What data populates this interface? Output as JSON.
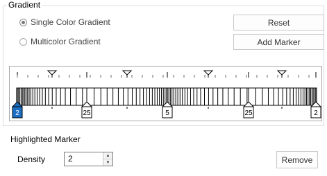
{
  "group": {
    "title": "Gradient"
  },
  "options": [
    {
      "label": "Single Color Gradient",
      "checked": true
    },
    {
      "label": "Multicolor Gradient",
      "checked": false
    }
  ],
  "buttons": {
    "reset": "Reset",
    "add_marker": "Add Marker",
    "remove": "Remove"
  },
  "markers": [
    "2",
    "25",
    "5",
    "25",
    "2"
  ],
  "selected_marker": 0,
  "highlighted": {
    "title": "Highlighted Marker",
    "density_label": "Density",
    "density_value": "2"
  },
  "colors": {
    "selected_marker": "#1c6fc3",
    "bar": "#000000",
    "border": "#a8a8a8"
  }
}
